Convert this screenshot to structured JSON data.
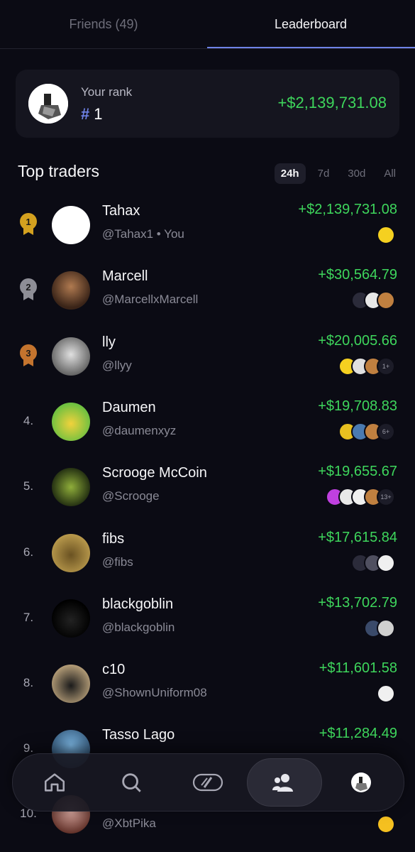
{
  "tabs": {
    "friends": "Friends (49)",
    "leaderboard": "Leaderboard"
  },
  "your_rank": {
    "label": "Your rank",
    "hash": "#",
    "rank": "1",
    "pnl": "+$2,139,731.08"
  },
  "section": {
    "title": "Top traders"
  },
  "ranges": [
    "24h",
    "7d",
    "30d",
    "All"
  ],
  "active_range": "24h",
  "colors": {
    "background": "#0b0b14",
    "card": "#15151f",
    "accent": "#6f83e8",
    "positive": "#3ed65c",
    "gold": "#d4a11f",
    "silver": "#8e8e96",
    "bronze": "#c4742e"
  },
  "traders": [
    {
      "rank": "1",
      "name": "Tahax",
      "handle": "@Tahax1 • You",
      "pnl": "+$2,139,731.08",
      "token_more": ""
    },
    {
      "rank": "2",
      "name": "Marcell",
      "handle": "@MarcellxMarcell",
      "pnl": "+$30,564.79",
      "token_more": ""
    },
    {
      "rank": "3",
      "name": "lly",
      "handle": "@llyy",
      "pnl": "+$20,005.66",
      "token_more": "1+"
    },
    {
      "rank": "4.",
      "name": "Daumen",
      "handle": "@daumenxyz",
      "pnl": "+$19,708.83",
      "token_more": "6+"
    },
    {
      "rank": "5.",
      "name": "Scrooge McCoin",
      "handle": "@Scrooge",
      "pnl": "+$19,655.67",
      "token_more": "13+"
    },
    {
      "rank": "6.",
      "name": "fibs",
      "handle": "@fibs",
      "pnl": "+$17,615.84",
      "token_more": ""
    },
    {
      "rank": "7.",
      "name": "blackgoblin",
      "handle": "@blackgoblin",
      "pnl": "+$13,702.79",
      "token_more": ""
    },
    {
      "rank": "8.",
      "name": "c10",
      "handle": "@ShownUniform08",
      "pnl": "+$11,601.58",
      "token_more": ""
    },
    {
      "rank": "9.",
      "name": "Tasso Lago",
      "handle": "",
      "pnl": "+$11,284.49",
      "token_more": ""
    },
    {
      "rank": "10.",
      "name": "",
      "handle": "@XbtPika",
      "pnl": "",
      "token_more": ""
    }
  ],
  "nav": [
    "home-icon",
    "search-icon",
    "swap-icon",
    "friends-icon",
    "profile-icon"
  ]
}
